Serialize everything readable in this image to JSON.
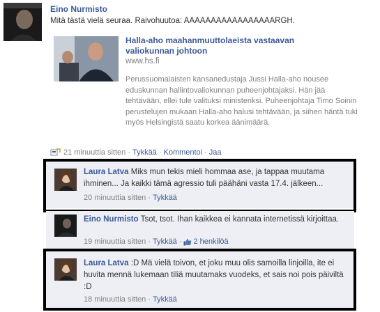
{
  "post": {
    "author": "Eino Nurmisto",
    "message": "Mitä tästä vielä seuraa. Raivohuutoa: AAAAAAAAAAAAAAAAARGH.",
    "shared_link": {
      "title": "Halla-aho maahanmuuttolaeista vastaavan valiokunnan johtoon",
      "source": "www.hs.fi",
      "description": "Perussuomalaisten kansanedustaja Jussi Halla-aho nousee eduskunnan hallintovaliokunnan puheenjohtajaksi. Hän jää tehtävään, ellei tule valituksi ministeriksi. Puheenjohtaja Timo Soinin perustelujen mukaan Halla-aho halusi tehtävään, ja siihen häntä tuki myös Helsingistä saatu korkea äänimäärä."
    },
    "meta": {
      "time": "21 minuuttia sitten",
      "like": "Tykkää",
      "comment": "Kommentoi",
      "share": "Jaa",
      "separator": "·"
    }
  },
  "comments": [
    {
      "author": "Laura Latva",
      "text": "Miks mun tekis mieli hommaa ase, ja tappaa muutama ihminen... Ja kaikki tämä agressio tuli päähäni vasta 17.4. jälkeen...",
      "time": "20 minuuttia sitten",
      "like": "Tykkää"
    },
    {
      "author": "Eino Nurmisto",
      "text": "Tsot, tsot. Ihan kaikkea ei kannata internetissä kirjoittaa.",
      "time": "19 minuuttia sitten",
      "like": "Tykkää",
      "likes_count": "2 henkilöä"
    },
    {
      "author": "Laura Latva",
      "text": ":D Mä vielä toivon, et joku muu olis samoilla linjoilla, ite ei huvita mennä lukemaan tiliä muutamaks vuodeks, et sais noi pois päiviltä :D",
      "time": "18 minuuttia sitten",
      "like": "Tykkää"
    }
  ],
  "colors": {
    "link": "#3b5998",
    "comment_bg": "#edeff4",
    "muted": "#808080",
    "highlight_border": "#000000"
  },
  "icons": {
    "post_meta": "link-share-icon",
    "like_count": "thumbs-up-icon"
  }
}
